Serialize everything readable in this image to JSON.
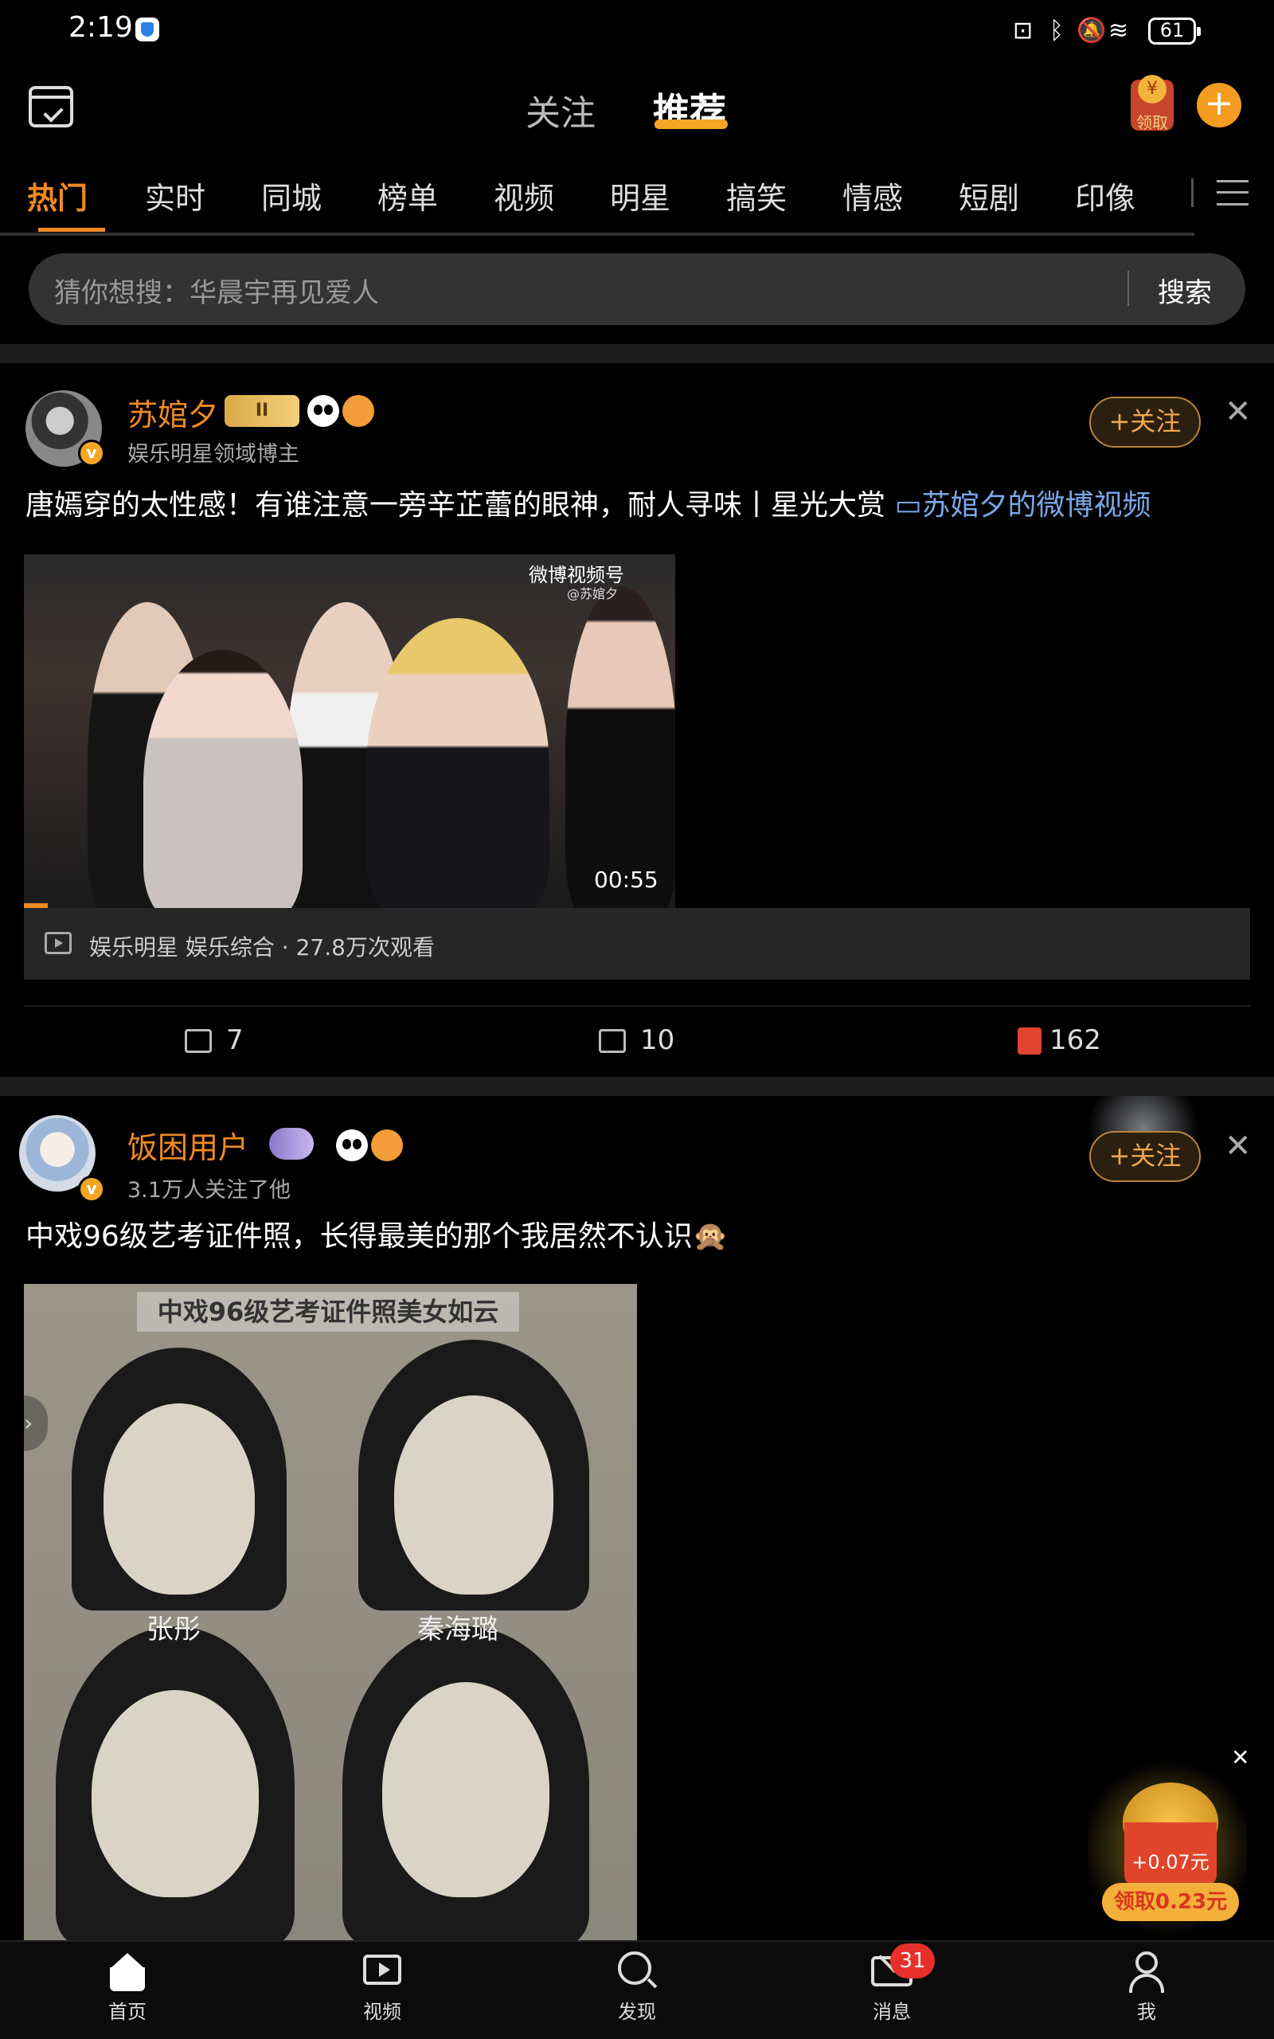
{
  "status_bar": {
    "time": "2:19",
    "battery": "61"
  },
  "header": {
    "tabs": [
      {
        "label": "关注",
        "active": false
      },
      {
        "label": "推荐",
        "active": true
      }
    ],
    "gift_label": "领取"
  },
  "channels": [
    "热门",
    "实时",
    "同城",
    "榜单",
    "视频",
    "明星",
    "搞笑",
    "情感",
    "短剧",
    "印像"
  ],
  "search": {
    "placeholder": "猜你想搜：华晨宇再见爱人",
    "button": "搜索"
  },
  "posts": [
    {
      "author": "苏婠夕",
      "subtitle": "娱乐明星领域博主",
      "follow_label": "+关注",
      "level_badge": "II",
      "text": "唐嫣穿的太性感！有谁注意一旁辛芷蕾的眼神，耐人寻味丨星光大赏",
      "link_text": "苏婠夕的微博视频",
      "video": {
        "duration": "00:55",
        "watermark": "微博视频号",
        "watermark_sub": "@苏婠夕",
        "meta": "娱乐明星 娱乐综合 · 27.8万次观看"
      },
      "actions": {
        "reposts": "7",
        "comments": "10",
        "likes": "162"
      }
    },
    {
      "author": "饭困用户",
      "subtitle": "3.1万人关注了他",
      "follow_label": "+关注",
      "text": "中戏96级艺考证件照，长得最美的那个我居然不认识🙊",
      "photo": {
        "title": "中戏96级艺考证件照美女如云",
        "labels": [
          "张彤",
          "秦海璐"
        ]
      }
    }
  ],
  "promo": {
    "amount": "+0.07元",
    "button": "领取0.23元"
  },
  "bottom_nav": [
    {
      "label": "首页",
      "icon": "home-icon"
    },
    {
      "label": "视频",
      "icon": "video-icon"
    },
    {
      "label": "发现",
      "icon": "discover-icon"
    },
    {
      "label": "消息",
      "icon": "message-icon"
    },
    {
      "label": "我",
      "icon": "profile-icon"
    }
  ],
  "message_badge": "31",
  "colors": {
    "accent": "#f08a24",
    "background": "#000000",
    "badge": "#e8302b"
  }
}
